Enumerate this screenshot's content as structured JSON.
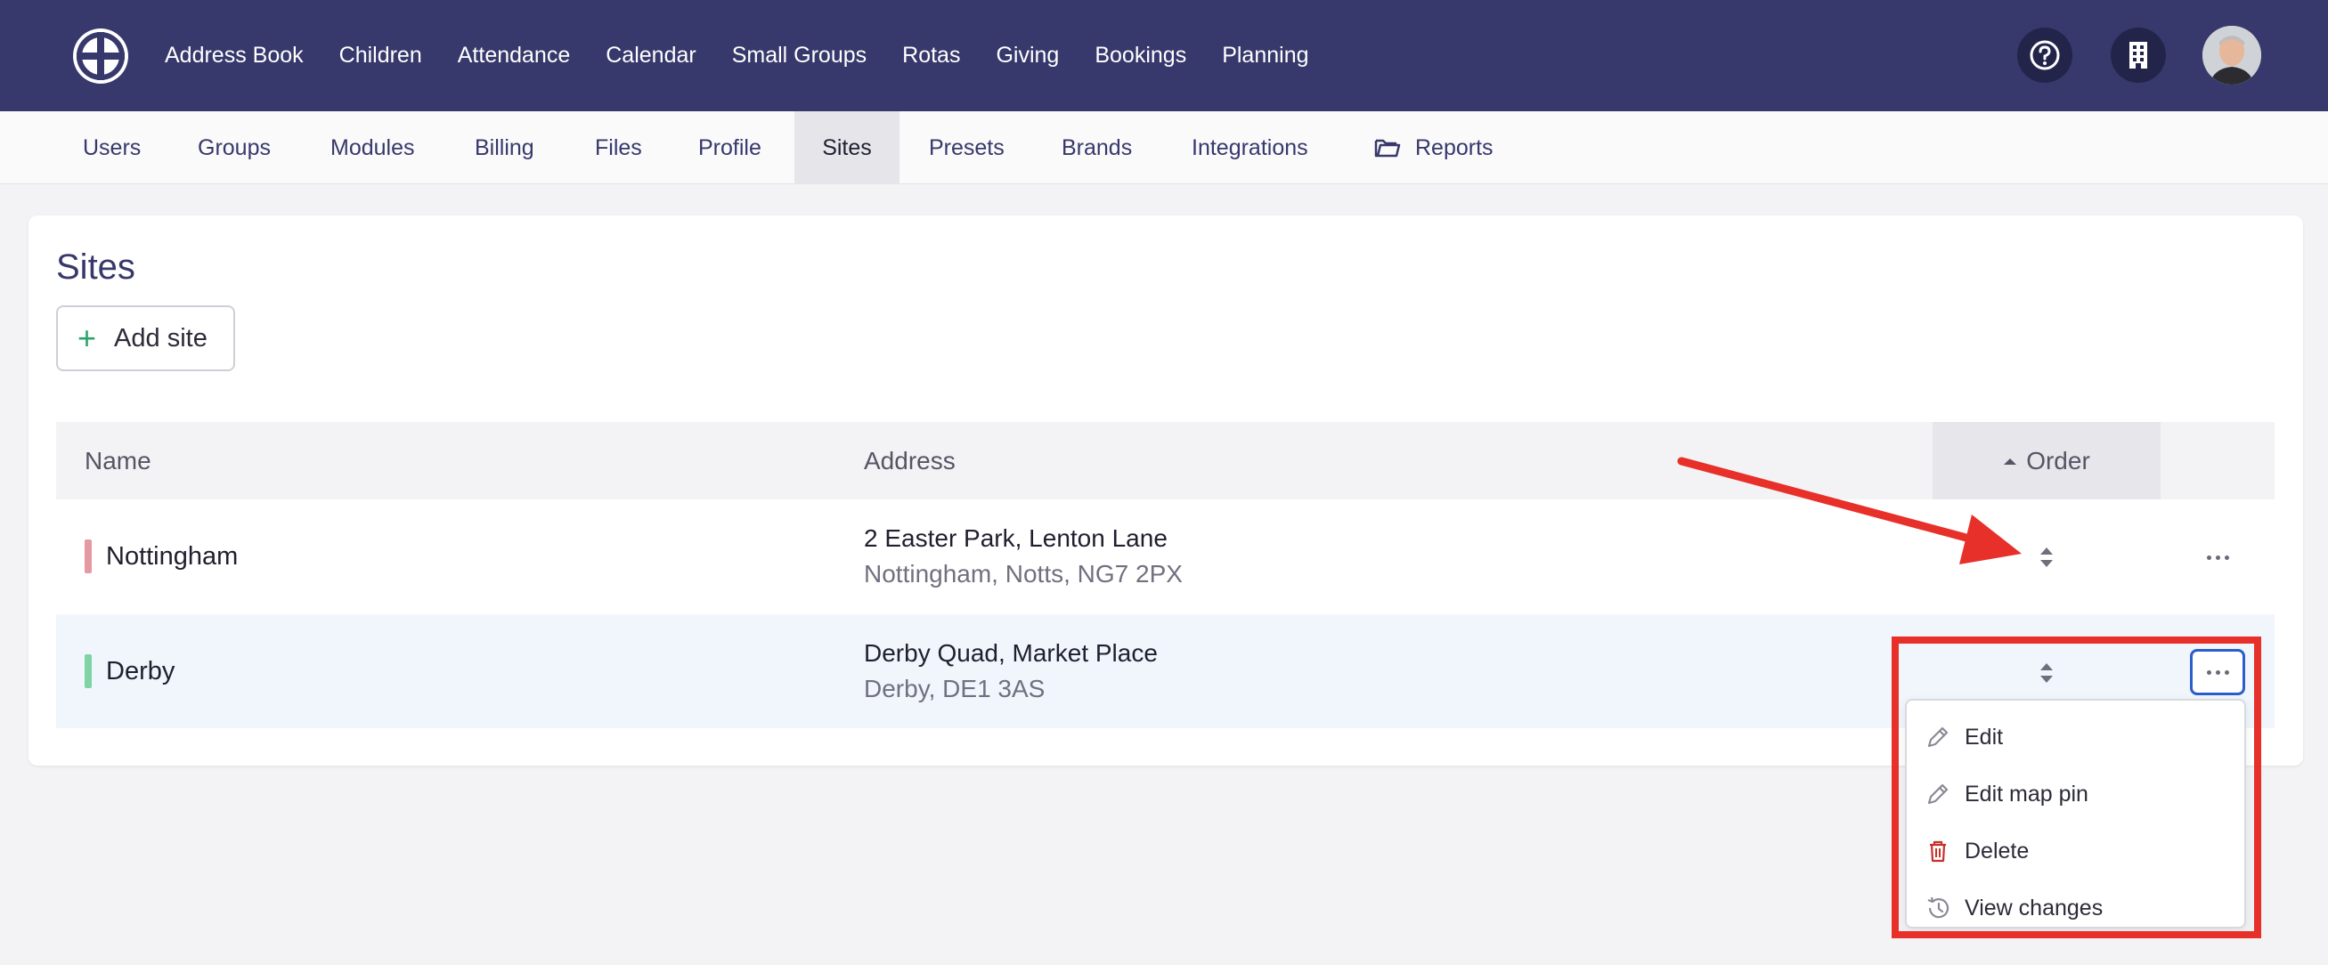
{
  "topnav": {
    "items": [
      "Address Book",
      "Children",
      "Attendance",
      "Calendar",
      "Small Groups",
      "Rotas",
      "Giving",
      "Bookings",
      "Planning"
    ]
  },
  "subnav": {
    "tabs": [
      "Users",
      "Groups",
      "Modules",
      "Billing",
      "Files",
      "Profile",
      "Sites",
      "Presets",
      "Brands",
      "Integrations",
      "Reports"
    ],
    "active": "Sites"
  },
  "page": {
    "title": "Sites",
    "add_label": "Add site"
  },
  "table": {
    "headers": {
      "name": "Name",
      "address": "Address",
      "order": "Order"
    },
    "rows": [
      {
        "name": "Nottingham",
        "address_line1": "2 Easter Park, Lenton Lane",
        "address_line2": "Nottingham, Notts, NG7 2PX",
        "color": "#e59aa2"
      },
      {
        "name": "Derby",
        "address_line1": "Derby Quad, Market Place",
        "address_line2": "Derby, DE1 3AS",
        "color": "#7fd3a4"
      }
    ]
  },
  "dropdown": {
    "items": [
      {
        "label": "Edit",
        "icon": "pencil-icon"
      },
      {
        "label": "Edit map pin",
        "icon": "pencil-icon"
      },
      {
        "label": "Delete",
        "icon": "trash-icon"
      },
      {
        "label": "View changes",
        "icon": "history-icon"
      }
    ]
  },
  "colors": {
    "nav_bg": "#37386b",
    "accent_green": "#2ea36d",
    "annotation_red": "#e8302a",
    "delete_red": "#c9302c",
    "focus_blue": "#2b5ec8"
  }
}
